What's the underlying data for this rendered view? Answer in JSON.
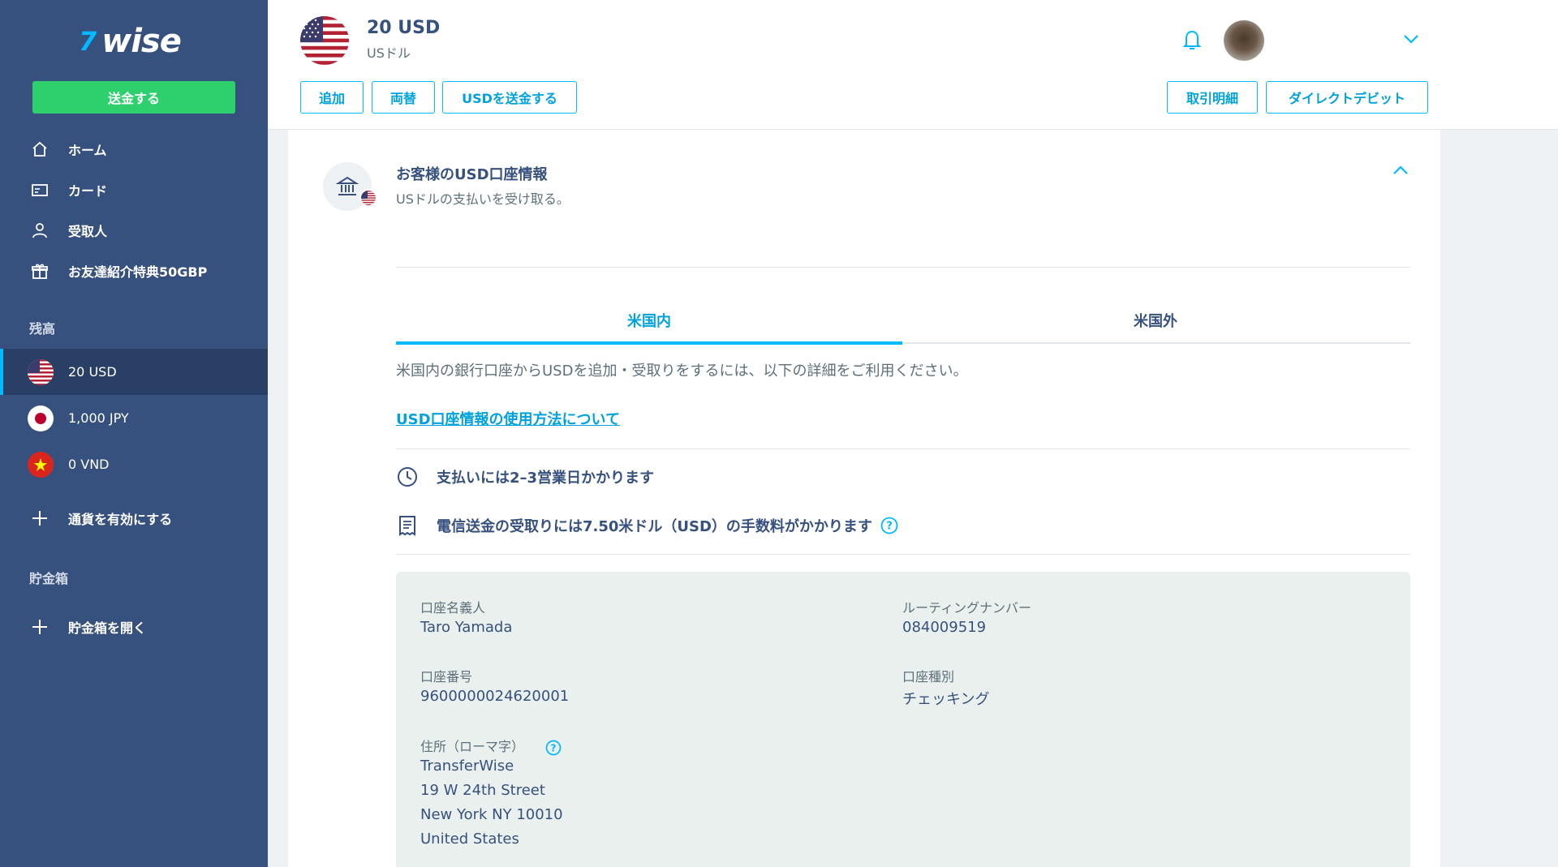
{
  "sidebar": {
    "logo_mark": "7",
    "logo_text": "wise",
    "send_button": "送金する",
    "nav": [
      {
        "label": "ホーム",
        "icon": "home-icon"
      },
      {
        "label": "カード",
        "icon": "card-icon"
      },
      {
        "label": "受取人",
        "icon": "recipient-icon"
      },
      {
        "label": "お友達紹介特典50GBP",
        "icon": "gift-icon"
      }
    ],
    "balances_heading": "残高",
    "balances": [
      {
        "label": "20 USD",
        "flag": "us-flag",
        "active": true
      },
      {
        "label": "1,000 JPY",
        "flag": "jp-flag",
        "active": false
      },
      {
        "label": "0 VND",
        "flag": "vn-flag",
        "active": false
      }
    ],
    "enable_currency": "通貨を有効にする",
    "jars_heading": "貯金箱",
    "open_jar": "貯金箱を開く"
  },
  "header": {
    "title": "20 USD",
    "subtitle": "USドル",
    "buttons": {
      "add": "追加",
      "convert": "両替",
      "send_usd": "USDを送金する",
      "statement": "取引明細",
      "direct_debit": "ダイレクトデビット"
    }
  },
  "account": {
    "title": "お客様のUSD口座情報",
    "subtitle": "USドルの支払いを受け取る。",
    "tabs": {
      "domestic": "米国内",
      "international": "米国外"
    },
    "intro": "米国内の銀行口座からUSDを追加・受取りをするには、以下の詳細をご利用ください。",
    "help_link": "USD口座情報の使用方法について",
    "info_time": "支払いには2–3営業日かかります",
    "info_fee": "電信送金の受取りには7.50米ドル（USD）の手数料がかかります",
    "details": {
      "holder_label": "口座名義人",
      "holder_value": "Taro Yamada",
      "routing_label": "ルーティングナンバー",
      "routing_value": "084009519",
      "account_label": "口座番号",
      "account_value": "9600000024620001",
      "type_label": "口座種別",
      "type_value": "チェッキング",
      "address_label": "住所（ローマ字）",
      "address_lines": [
        "TransferWise",
        "19 W 24th Street",
        "New York NY 10010",
        "United States"
      ]
    }
  },
  "colors": {
    "sidebar": "#37517e",
    "accent": "#00b9ff",
    "send_green": "#2ed06e",
    "details_bg": "#eaf0ee"
  }
}
